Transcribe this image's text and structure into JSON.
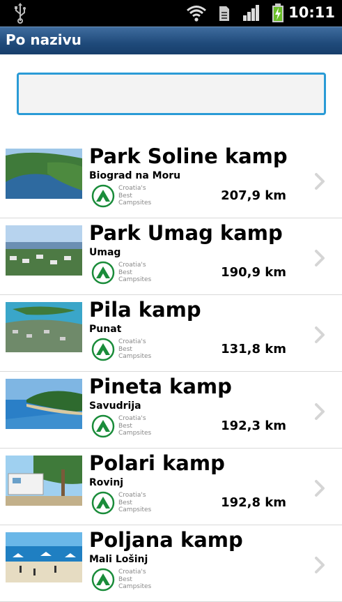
{
  "status_bar": {
    "time": "10:11",
    "icons": [
      "usb-icon",
      "wifi-icon",
      "sd-card-icon",
      "signal-icon",
      "battery-charging-icon"
    ]
  },
  "title_bar": {
    "title": "Po nazivu"
  },
  "search": {
    "value": "",
    "placeholder": ""
  },
  "badge": {
    "lines": [
      "Croatia's",
      "Best",
      "Campsites"
    ],
    "color": "#1a8c3a"
  },
  "accent_color": "#2a9bd6",
  "campsites": [
    {
      "name": "Park Soline kamp",
      "place": "Biograd na Moru",
      "distance": "207,9 km"
    },
    {
      "name": "Park Umag kamp",
      "place": "Umag",
      "distance": "190,9 km"
    },
    {
      "name": "Pila kamp",
      "place": "Punat",
      "distance": "131,8 km"
    },
    {
      "name": "Pineta kamp",
      "place": "Savudrija",
      "distance": "192,3 km"
    },
    {
      "name": "Polari kamp",
      "place": "Rovinj",
      "distance": "192,8 km"
    },
    {
      "name": "Poljana kamp",
      "place": "Mali Lošinj",
      "distance": ""
    }
  ]
}
